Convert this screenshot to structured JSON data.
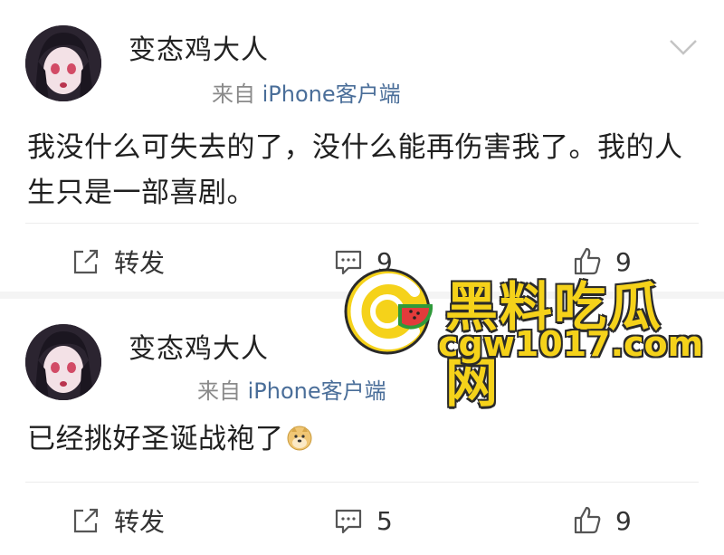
{
  "posts": [
    {
      "username": "变态鸡大人",
      "source_prefix": "来自 ",
      "source_device": "iPhone客户端",
      "content": "我没什么可失去的了，没什么能再伤害我了。我的人生只是一部喜剧。",
      "repost_label": "转发",
      "comment_count": "9",
      "like_count": "9"
    },
    {
      "username": "变态鸡大人",
      "source_prefix": "来自 ",
      "source_device": "iPhone客户端",
      "content": "已经挑好圣诞战袍了",
      "repost_label": "转发",
      "comment_count": "5",
      "like_count": "9"
    }
  ],
  "watermark": {
    "title": "黑料吃瓜网",
    "url": "cgw1017.com"
  },
  "colors": {
    "link": "#4a6e99",
    "muted": "#8a8a8a",
    "watermark": "#f5d21a"
  },
  "icons": [
    "chevron-down-icon",
    "repost-icon",
    "comment-icon",
    "like-icon",
    "doge-emoji-icon"
  ]
}
